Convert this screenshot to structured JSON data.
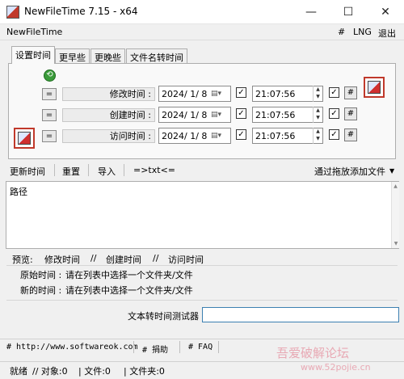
{
  "window": {
    "title": "NewFileTime 7.15 - x64",
    "minimize": "—",
    "maximize": "☐",
    "close": "✕"
  },
  "menubar": {
    "app_name": "NewFileTime",
    "items": [
      "#",
      "LNG",
      "退出"
    ]
  },
  "tabs": [
    "设置时间",
    "更早些",
    "更晚些",
    "文件名转时间"
  ],
  "tab_active": 0,
  "time_rows": [
    {
      "eq": "=",
      "label": "修改时间 :",
      "date": "2024/ 1/ 8",
      "time": "21:07:56",
      "checked_date": true,
      "checked_time": true,
      "hash": "#"
    },
    {
      "eq": "=",
      "label": "创建时间 :",
      "date": "2024/ 1/ 8",
      "time": "21:07:56",
      "checked_date": true,
      "checked_time": true,
      "hash": "#"
    },
    {
      "eq": "=",
      "label": "访问时间 :",
      "date": "2024/ 1/ 8",
      "time": "21:07:56",
      "checked_date": true,
      "checked_time": true,
      "hash": "#"
    }
  ],
  "toolbar": {
    "update_time": "更新时间",
    "reset": "重置",
    "import": "导入",
    "txt": "=>txt<=",
    "drag_add": "通过拖放添加文件",
    "drag_arrow": "▼"
  },
  "list": {
    "column_header": "路径"
  },
  "preview": {
    "header": [
      "预览:",
      "修改时间",
      "//",
      "创建时间",
      "//",
      "访问时间"
    ],
    "original_label": "原始时间 :",
    "original_value": "请在列表中选择一个文件夹/文件",
    "new_label": "新的时间 :",
    "new_value": "请在列表中选择一个文件夹/文件"
  },
  "text_tester": {
    "label": "文本转时间测试器",
    "value": ""
  },
  "bottom_links": [
    "# http://www.softwareok.com",
    "# 捐助",
    "# FAQ"
  ],
  "status": {
    "ready": "就绪",
    "objects": "// 对象:0",
    "files": "| 文件:0",
    "folders": "| 文件夹:0"
  },
  "watermark": {
    "line1": "吾爱破解论坛",
    "line2": "www.52pojie.cn"
  },
  "colors": {
    "accent": "#3c7fb1",
    "icon_red": "#c0392b"
  }
}
